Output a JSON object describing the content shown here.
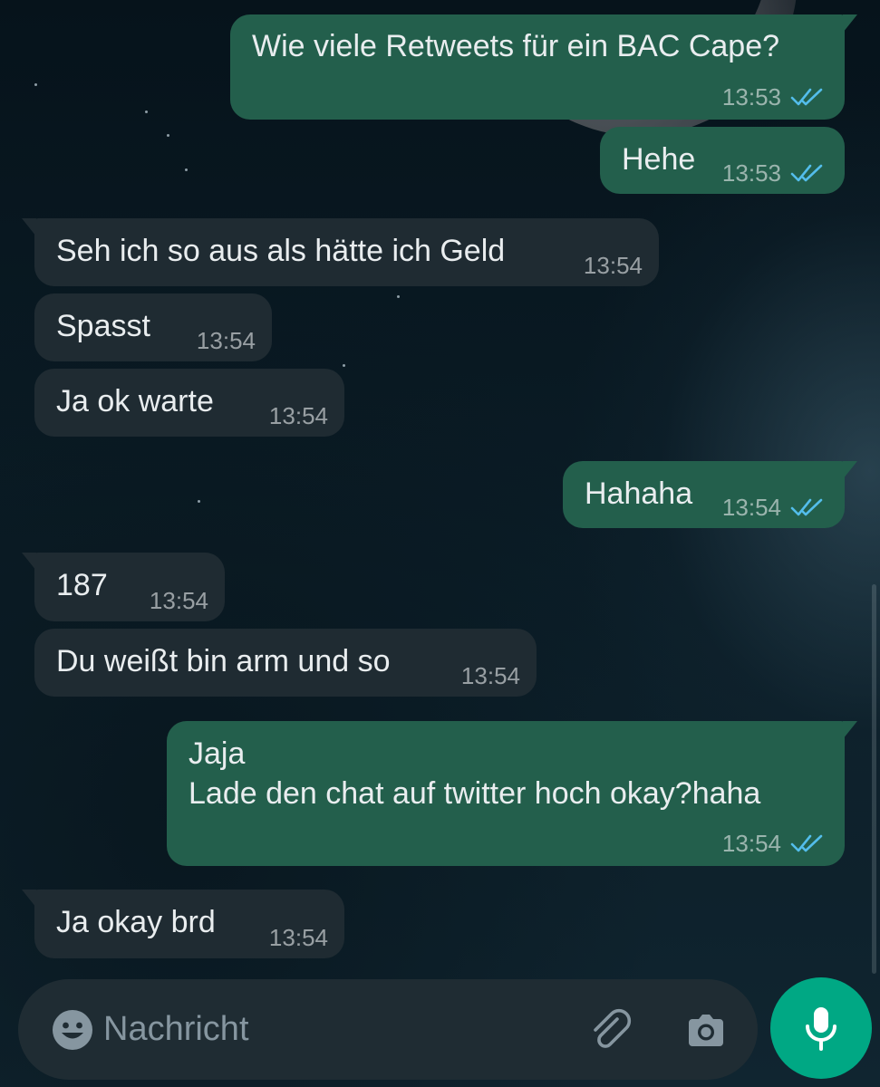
{
  "colors": {
    "outgoing_bubble": "#235f4c",
    "incoming_bubble": "#1f2b32",
    "read_ticks": "#53bdeb",
    "mic_button": "#00a884",
    "input_bar": "#1f2c33"
  },
  "messages": [
    {
      "direction": "outgoing",
      "text": "Wie viele Retweets für ein BAC Cape?",
      "time": "13:53",
      "status": "read"
    },
    {
      "direction": "outgoing",
      "text": "Hehe",
      "time": "13:53",
      "status": "read"
    },
    {
      "direction": "incoming",
      "text": "Seh ich so aus als hätte ich Geld",
      "time": "13:54"
    },
    {
      "direction": "incoming",
      "text": "Spasst",
      "time": "13:54"
    },
    {
      "direction": "incoming",
      "text": "Ja ok warte",
      "time": "13:54"
    },
    {
      "direction": "outgoing",
      "text": "Hahaha",
      "time": "13:54",
      "status": "read"
    },
    {
      "direction": "incoming",
      "text": "187",
      "time": "13:54"
    },
    {
      "direction": "incoming",
      "text": "Du weißt bin arm und so",
      "time": "13:54"
    },
    {
      "direction": "outgoing",
      "text": "Jaja\nLade den chat auf twitter hoch okay?haha",
      "time": "13:54",
      "status": "read"
    },
    {
      "direction": "incoming",
      "text": "Ja okay brd",
      "time": "13:54"
    }
  ],
  "composer": {
    "placeholder": "Nachricht",
    "emoji_icon": "emoji-icon",
    "attach_icon": "paperclip-icon",
    "camera_icon": "camera-icon",
    "mic_icon": "microphone-icon"
  }
}
